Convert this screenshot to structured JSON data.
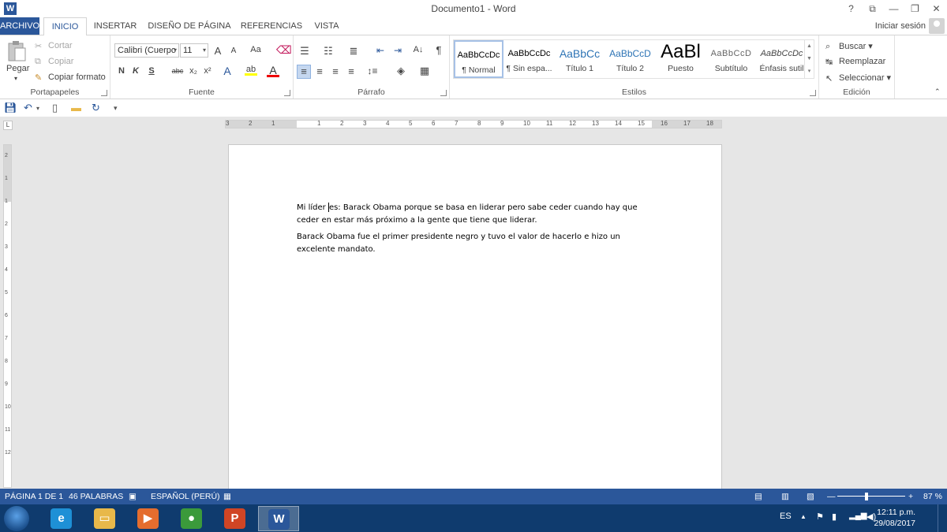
{
  "window": {
    "title": "Documento1 - Word",
    "help": "?",
    "ribbon_display": "⧉",
    "minimize": "—",
    "restore": "❐",
    "close": "✕"
  },
  "tabs": {
    "archivo": "ARCHIVO",
    "inicio": "INICIO",
    "insertar": "INSERTAR",
    "diseno": "DISEÑO DE PÁGINA",
    "referencias": "REFERENCIAS",
    "vista": "VISTA",
    "signin": "Iniciar sesión"
  },
  "ribbon": {
    "clipboard": {
      "paste": "Pegar",
      "cut": "Cortar",
      "copy": "Copiar",
      "format_painter": "Copiar formato",
      "label": "Portapapeles"
    },
    "font": {
      "name": "Calibri (Cuerpo",
      "size": "11",
      "grow": "A",
      "shrink": "A",
      "case": "Aa",
      "bold": "N",
      "italic": "K",
      "underline": "S",
      "strike": "abc",
      "subscript": "x₂",
      "superscript": "x²",
      "label": "Fuente"
    },
    "paragraph": {
      "pilcrow": "¶",
      "sort": "A↓",
      "label": "Párrafo"
    },
    "styles": {
      "items": [
        {
          "sample": "AaBbCcDc",
          "name": "¶ Normal"
        },
        {
          "sample": "AaBbCcDc",
          "name": "¶ Sin espa..."
        },
        {
          "sample": "AaBbCc",
          "name": "Título 1"
        },
        {
          "sample": "AaBbCcD",
          "name": "Título 2"
        },
        {
          "sample": "AaBl",
          "name": "Puesto"
        },
        {
          "sample": "AaBbCcD",
          "name": "Subtítulo"
        },
        {
          "sample": "AaBbCcDc",
          "name": "Énfasis sutil"
        }
      ],
      "label": "Estilos"
    },
    "editing": {
      "find": "Buscar",
      "replace": "Reemplazar",
      "select": "Seleccionar",
      "label": "Edición"
    }
  },
  "ruler": {
    "h_numbers": [
      "3",
      "2",
      "1",
      "1",
      "2",
      "3",
      "4",
      "5",
      "6",
      "7",
      "8",
      "9",
      "10",
      "11",
      "12",
      "13",
      "14",
      "15",
      "16",
      "17",
      "18"
    ],
    "v_numbers": [
      "2",
      "1",
      "1",
      "2",
      "3",
      "4",
      "5",
      "6",
      "7",
      "8",
      "9",
      "10",
      "11",
      "12"
    ],
    "tab_selector": "L"
  },
  "document": {
    "para1_before_cursor": "Mi líder ",
    "para1_after_cursor": "es: Barack Obama porque se basa en liderar pero sabe ceder cuando hay que ceder en estar más próximo a la gente que tiene que liderar.",
    "para2": "Barack Obama fue el primer presidente negro y tuvo el valor de hacerlo e hizo un excelente mandato."
  },
  "status": {
    "page": "PÁGINA 1 DE 1",
    "words": "46 PALABRAS",
    "language": "ESPAÑOL (PERÚ)",
    "zoom_minus": "—",
    "zoom_plus": "+",
    "zoom": "87 %",
    "zoom_level": 0.87
  },
  "taskbar": {
    "apps": [
      {
        "name": "internet-explorer",
        "glyph": "e",
        "color": "#1e90d6"
      },
      {
        "name": "file-explorer",
        "glyph": "▭",
        "color": "#e8b84a"
      },
      {
        "name": "media-player",
        "glyph": "▶",
        "color": "#e46d2e"
      },
      {
        "name": "chrome",
        "glyph": "●",
        "color": "#3b9a3b"
      },
      {
        "name": "powerpoint",
        "glyph": "P",
        "color": "#d04525"
      },
      {
        "name": "word",
        "glyph": "W",
        "color": "#2b579a"
      }
    ],
    "lang": "ES",
    "time": "12:11 p.m.",
    "date": "29/08/2017"
  },
  "colors": {
    "accent": "#2b579a",
    "taskbar": "#0f3b6e"
  }
}
